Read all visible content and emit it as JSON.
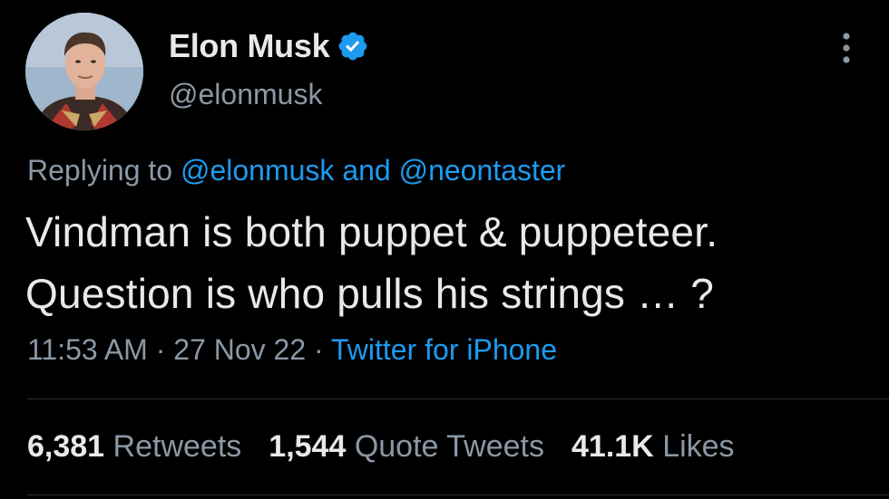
{
  "author": {
    "display_name": "Elon Musk",
    "handle": "@elonmusk",
    "verified": true,
    "avatar_icon": "profile-photo"
  },
  "reply": {
    "prefix": "Replying to",
    "mention_1": "@elonmusk",
    "joiner": "and",
    "mention_2": "@neontaster"
  },
  "tweet": {
    "text": "Vindman is both puppet & puppeteer.\nQuestion is who pulls his strings … ?"
  },
  "meta": {
    "time": "11:53 AM",
    "separator": "·",
    "date": "27 Nov 22",
    "source": "Twitter for iPhone"
  },
  "stats": {
    "retweets_count": "6,381",
    "retweets_label": "Retweets",
    "quotes_count": "1,544",
    "quotes_label": "Quote Tweets",
    "likes_count": "41.1K",
    "likes_label": "Likes"
  },
  "colors": {
    "background": "#000000",
    "primary_text": "#e7e9ea",
    "secondary_text": "#8b98a5",
    "link": "#1d9bf0",
    "verified": "#1d9bf0",
    "divider": "#2f3336"
  }
}
